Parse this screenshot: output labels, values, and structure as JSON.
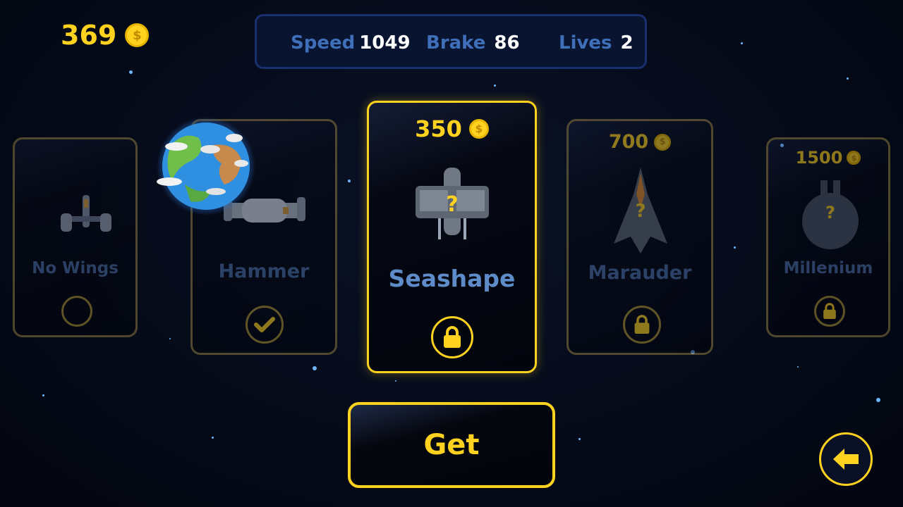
{
  "currency": {
    "amount": "369",
    "icon": "coin-icon",
    "symbol": "$"
  },
  "stats": {
    "speed_label": "Speed",
    "speed_value": "1049",
    "brake_label": "Brake",
    "brake_value": "86",
    "lives_label": "Lives",
    "lives_value": "2"
  },
  "ships": [
    {
      "name": "No Wings",
      "price": "",
      "status": "empty",
      "status_icon": "circle-icon"
    },
    {
      "name": "Hammer",
      "price": "",
      "status": "owned",
      "status_icon": "checkmark-icon"
    },
    {
      "name": "Seashape",
      "price": "350",
      "status": "locked",
      "status_icon": "lock-icon",
      "selected": true
    },
    {
      "name": "Marauder",
      "price": "700",
      "status": "locked",
      "status_icon": "lock-icon"
    },
    {
      "name": "Millenium",
      "price": "1500",
      "status": "locked",
      "status_icon": "lock-icon"
    }
  ],
  "unknown_mark": "?",
  "actions": {
    "get_label": "Get",
    "back_icon": "back-arrow-icon"
  },
  "colors": {
    "gold": "#ffd21f",
    "label_blue": "#3f6fb8",
    "name_blue": "#4a6da3",
    "background": "#050a18"
  }
}
